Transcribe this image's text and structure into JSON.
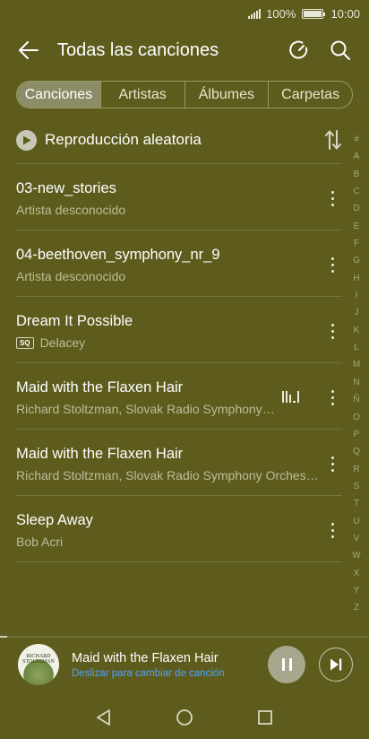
{
  "status_bar": {
    "battery_text": "100%",
    "time": "10:00"
  },
  "header": {
    "title": "Todas las canciones",
    "icons": [
      "back-arrow-icon",
      "refresh-icon",
      "search-icon"
    ]
  },
  "tabs": [
    {
      "label": "Canciones",
      "active": true
    },
    {
      "label": "Artistas",
      "active": false
    },
    {
      "label": "Álbumes",
      "active": false
    },
    {
      "label": "Carpetas",
      "active": false
    }
  ],
  "shuffle": {
    "label": "Reproducción aleatoria"
  },
  "songs": [
    {
      "title": "03-new_stories",
      "artist": "Artista desconocido",
      "badge": "",
      "playing": false
    },
    {
      "title": "04-beethoven_symphony_nr_9",
      "artist": "Artista desconocido",
      "badge": "",
      "playing": false
    },
    {
      "title": "Dream It Possible",
      "artist": "Delacey",
      "badge": "SQ",
      "playing": false
    },
    {
      "title": "Maid with the Flaxen Hair",
      "artist": "Richard Stoltzman, Slovak Radio Symphony Orchestra",
      "badge": "",
      "playing": true
    },
    {
      "title": "Maid with the Flaxen Hair",
      "artist": "Richard Stoltzman, Slovak Radio Symphony Orchestra",
      "badge": "",
      "playing": false
    },
    {
      "title": "Sleep Away",
      "artist": "Bob Acri",
      "badge": "",
      "playing": false
    }
  ],
  "alpha_index": [
    "#",
    "A",
    "B",
    "C",
    "D",
    "E",
    "F",
    "G",
    "H",
    "I",
    "J",
    "K",
    "L",
    "M",
    "N",
    "Ñ",
    "O",
    "P",
    "Q",
    "R",
    "S",
    "T",
    "U",
    "V",
    "W",
    "X",
    "Y",
    "Z"
  ],
  "mini_player": {
    "album_art_text": "RICHARD STOLTZMAN",
    "title": "Maid with the Flaxen Hair",
    "subtitle": "Deslizar para cambiar de canción",
    "progress": 0.02
  },
  "colors": {
    "background": "#5d5c1d",
    "accent_link": "#4da3ff"
  }
}
